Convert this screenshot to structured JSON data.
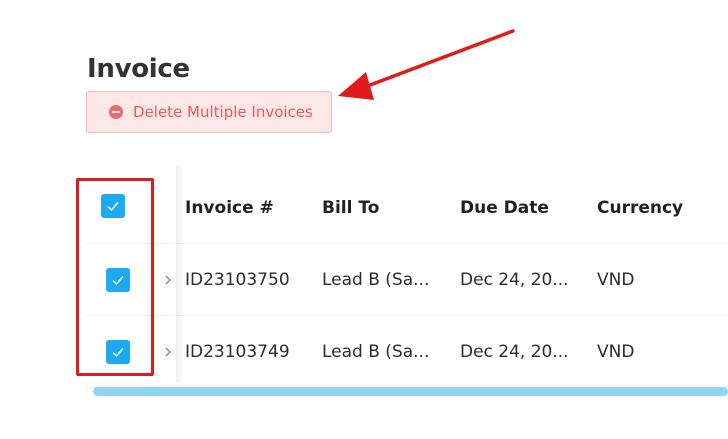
{
  "page": {
    "title": "Invoice",
    "delete_button_label": "Delete Multiple Invoices"
  },
  "table": {
    "columns": [
      "Invoice #",
      "Bill To",
      "Due Date",
      "Currency"
    ],
    "rows": [
      {
        "invoice": "ID23103750",
        "bill_to": "Lead B (Sa...",
        "due_date": "Dec 24, 20...",
        "currency": "VND",
        "checked": true
      },
      {
        "invoice": "ID23103749",
        "bill_to": "Lead B (Sa...",
        "due_date": "Dec 24, 20...",
        "currency": "VND",
        "checked": true
      }
    ],
    "select_all_checked": true
  },
  "colors": {
    "accent": "#1eaaf1",
    "danger": "#ec5b5b",
    "annotation": "#e01b1b",
    "scrollbar": "#8fd6f4"
  },
  "icons": {
    "delete": "minus-circle-icon",
    "checkbox": "check-icon",
    "expand": "chevron-right-icon",
    "annotation": "arrow-icon"
  }
}
